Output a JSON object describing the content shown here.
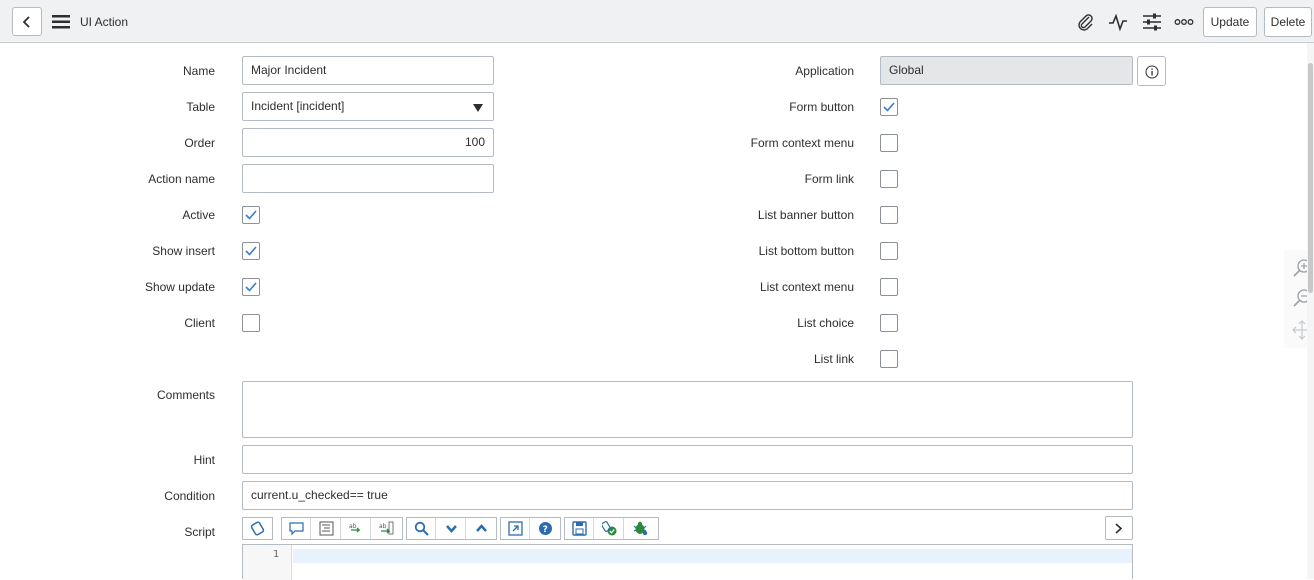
{
  "header": {
    "title": "UI Action",
    "update_label": "Update",
    "delete_label": "Delete"
  },
  "form": {
    "name": {
      "label": "Name",
      "value": "Major Incident"
    },
    "table": {
      "label": "Table",
      "value": "Incident [incident]"
    },
    "order": {
      "label": "Order",
      "value": "100"
    },
    "action_name": {
      "label": "Action name",
      "value": ""
    },
    "active": {
      "label": "Active",
      "checked": true
    },
    "show_insert": {
      "label": "Show insert",
      "checked": true
    },
    "show_update": {
      "label": "Show update",
      "checked": true
    },
    "client": {
      "label": "Client",
      "checked": false
    },
    "application": {
      "label": "Application",
      "value": "Global"
    },
    "form_button": {
      "label": "Form button",
      "checked": true
    },
    "form_context_menu": {
      "label": "Form context menu",
      "checked": false
    },
    "form_link": {
      "label": "Form link",
      "checked": false
    },
    "list_banner_button": {
      "label": "List banner button",
      "checked": false
    },
    "list_bottom_button": {
      "label": "List bottom button",
      "checked": false
    },
    "list_context_menu": {
      "label": "List context menu",
      "checked": false
    },
    "list_choice": {
      "label": "List choice",
      "checked": false
    },
    "list_link": {
      "label": "List link",
      "checked": false
    },
    "comments": {
      "label": "Comments",
      "value": ""
    },
    "hint": {
      "label": "Hint",
      "value": ""
    },
    "condition": {
      "label": "Condition",
      "value": "current.u_checked== true"
    },
    "script": {
      "label": "Script",
      "line_number": "1"
    }
  },
  "colors": {
    "accent": "#1f8476",
    "check": "#3a7dc9",
    "toolbar_icon": "#2b6cb0"
  }
}
